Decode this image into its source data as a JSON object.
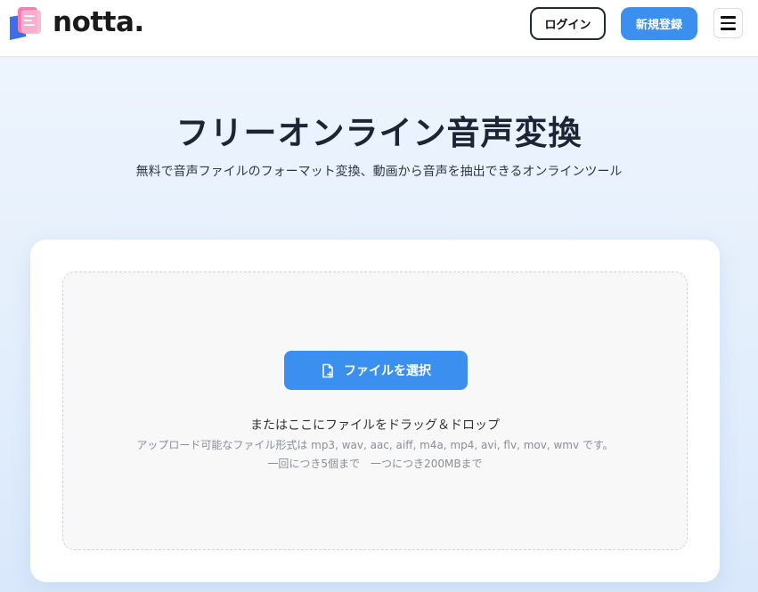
{
  "header": {
    "brand": "notta.",
    "login_label": "ログイン",
    "signup_label": "新規登録",
    "menu_icon": "hamburger-icon"
  },
  "hero": {
    "title": "フリーオンライン音声変換",
    "subtitle": "無料で音声ファイルのフォーマット変換、動画から音声を抽出できるオンラインツール"
  },
  "upload": {
    "select_label": "ファイルを選択",
    "select_icon": "file-add-icon",
    "drop_text": "またはここにファイルをドラッグ＆ドロップ",
    "formats_text": "アップロード可能なファイル形式は mp3, wav, aac, aiff, m4a, mp4, avi, flv, mov, wmv です。",
    "limits_text": "一回につき5個まで　一つにつき200MBまで"
  },
  "colors": {
    "accent": "#3b8fef",
    "title": "#1c2536",
    "background": "#eaf2fd"
  }
}
